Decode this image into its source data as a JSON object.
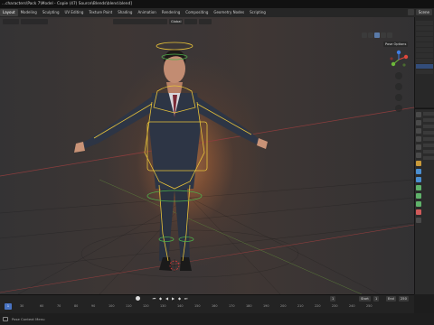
{
  "window": {
    "title": "...characters\\Pack 7\\Model - Copie (47) Source\\Blends\\blend.blend]"
  },
  "workspaces": [
    {
      "label": "Layout",
      "active": true
    },
    {
      "label": "Modeling",
      "active": false
    },
    {
      "label": "Sculpting",
      "active": false
    },
    {
      "label": "UV Editing",
      "active": false
    },
    {
      "label": "Texture Paint",
      "active": false
    },
    {
      "label": "Shading",
      "active": false
    },
    {
      "label": "Animation",
      "active": false
    },
    {
      "label": "Rendering",
      "active": false
    },
    {
      "label": "Compositing",
      "active": false
    },
    {
      "label": "Geometry Nodes",
      "active": false
    },
    {
      "label": "Scripting",
      "active": false
    }
  ],
  "header_right": {
    "scene_label": "Scene"
  },
  "viewport": {
    "transform_orientation": "Global",
    "pose_options_label": "Pose Options",
    "gizmo_axes": [
      {
        "axis": "x",
        "color": "#e0483c"
      },
      {
        "axis": "y",
        "color": "#6cb83a"
      },
      {
        "axis": "z",
        "color": "#3f7de3"
      }
    ]
  },
  "timeline": {
    "current_frame": "1",
    "start_label": "Start",
    "start_value": "1",
    "end_label": "End",
    "end_value": "250",
    "ruler_ticks": [
      "1",
      "30",
      "60",
      "70",
      "80",
      "90",
      "100",
      "110",
      "120",
      "130",
      "140",
      "150",
      "160",
      "170",
      "180",
      "190",
      "200",
      "210",
      "220",
      "230",
      "240",
      "250"
    ]
  },
  "statusbar": {
    "hint": "Pose Context Menu"
  },
  "colors": {
    "bone_highlight": "#e8c33a",
    "accent_blue": "#4873c2"
  }
}
